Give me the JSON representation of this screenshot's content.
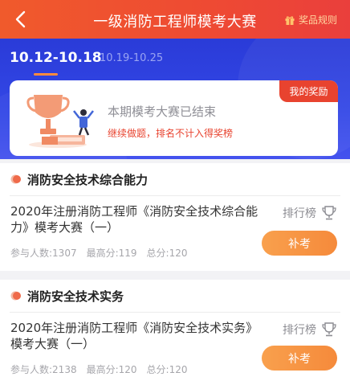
{
  "header": {
    "title": "一级消防工程师模考大赛",
    "rules_label": "奖品规则"
  },
  "period_tabs": [
    {
      "label": "10.12-10.18",
      "active": true
    },
    {
      "label": "10.19-10.25",
      "active": false
    }
  ],
  "status_card": {
    "reward_badge": "我的奖励",
    "ended_text": "本期模考大赛已结束",
    "continue_text": "继续做题，排名不计入得奖榜"
  },
  "sections": [
    {
      "title": "消防安全技术综合能力",
      "exam_name": "2020年注册消防工程师《消防安全技术综合能力》模考大赛（一）",
      "rank_label": "排行榜",
      "participants": "参与人数:1307",
      "max_score": "最高分:119",
      "total_score": "总分:120",
      "button_label": "补考"
    },
    {
      "title": "消防安全技术实务",
      "exam_name": "2020年注册消防工程师《消防安全技术实务》模考大赛（一）",
      "rank_label": "排行榜",
      "participants": "参与人数:2138",
      "max_score": "最高分:120",
      "total_score": "总分:120",
      "button_label": "补考"
    }
  ],
  "colors": {
    "accent": "#ee4a33",
    "hero_blue": "#3347e6",
    "button_orange": "#f58a3b"
  }
}
